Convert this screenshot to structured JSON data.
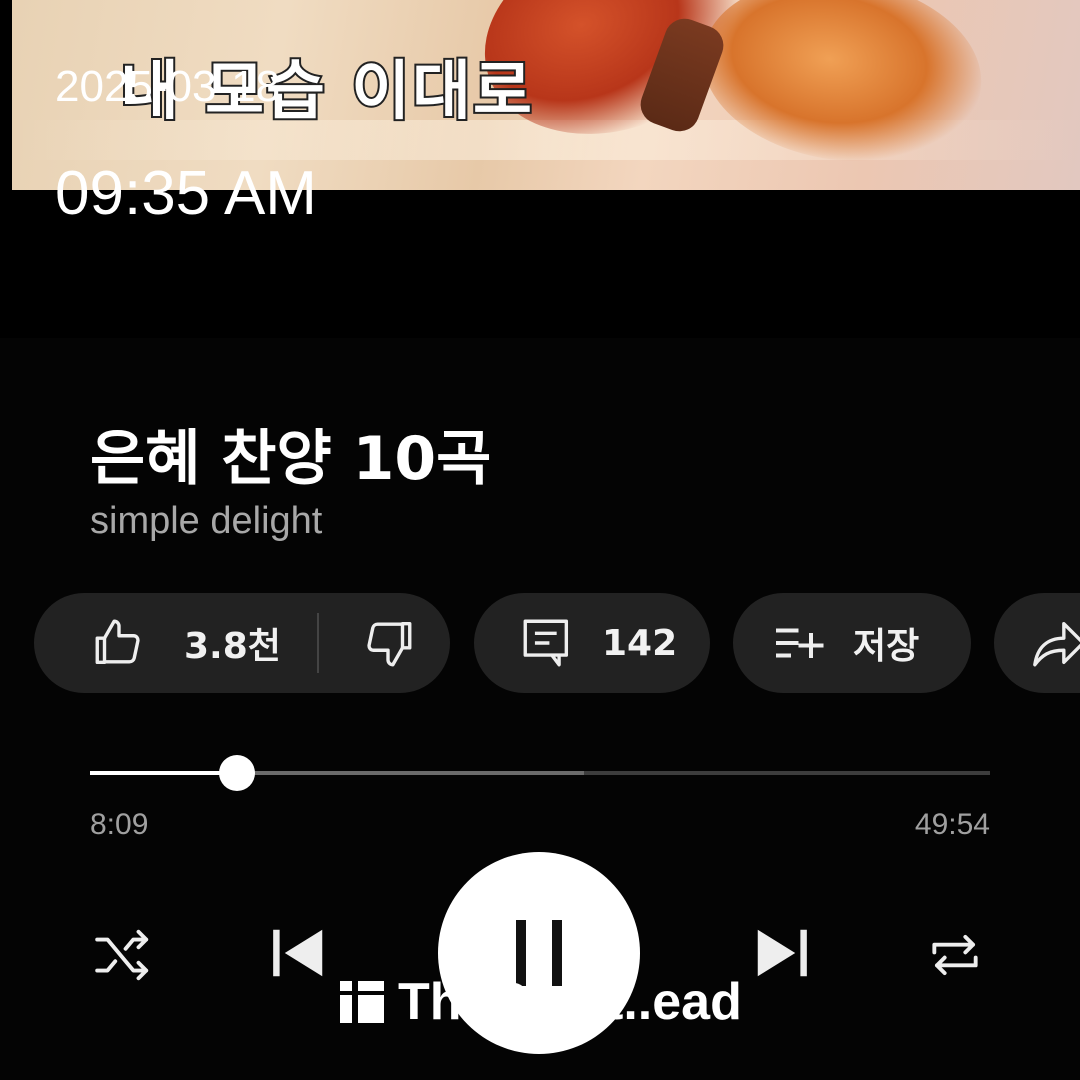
{
  "overlay": {
    "date": "2025-03-18",
    "time": "09:35 AM"
  },
  "video": {
    "thumbnail_caption": "내 모습 이대로"
  },
  "track": {
    "title": "은혜 찬양 10곡",
    "artist": "simple delight"
  },
  "actions": {
    "like_count": "3.8천",
    "comment_count": "142",
    "save_label": "저장"
  },
  "progress": {
    "elapsed": "8:09",
    "total": "49:54",
    "played_fraction": 0.163,
    "buffered_fraction": 0.549
  },
  "player": {
    "state": "playing"
  },
  "watermark": {
    "text": "TheQuiet..ead"
  },
  "icons": [
    "like-icon",
    "dislike-icon",
    "comment-icon",
    "save-playlist-icon",
    "share-icon",
    "shuffle-icon",
    "previous-icon",
    "pause-icon",
    "next-icon",
    "repeat-icon"
  ],
  "colors": {
    "background": "#000000",
    "pill": "#222222",
    "muted_text": "#a8a8a8",
    "track_played": "#ffffff",
    "track_remaining": "#3d3d3d"
  }
}
